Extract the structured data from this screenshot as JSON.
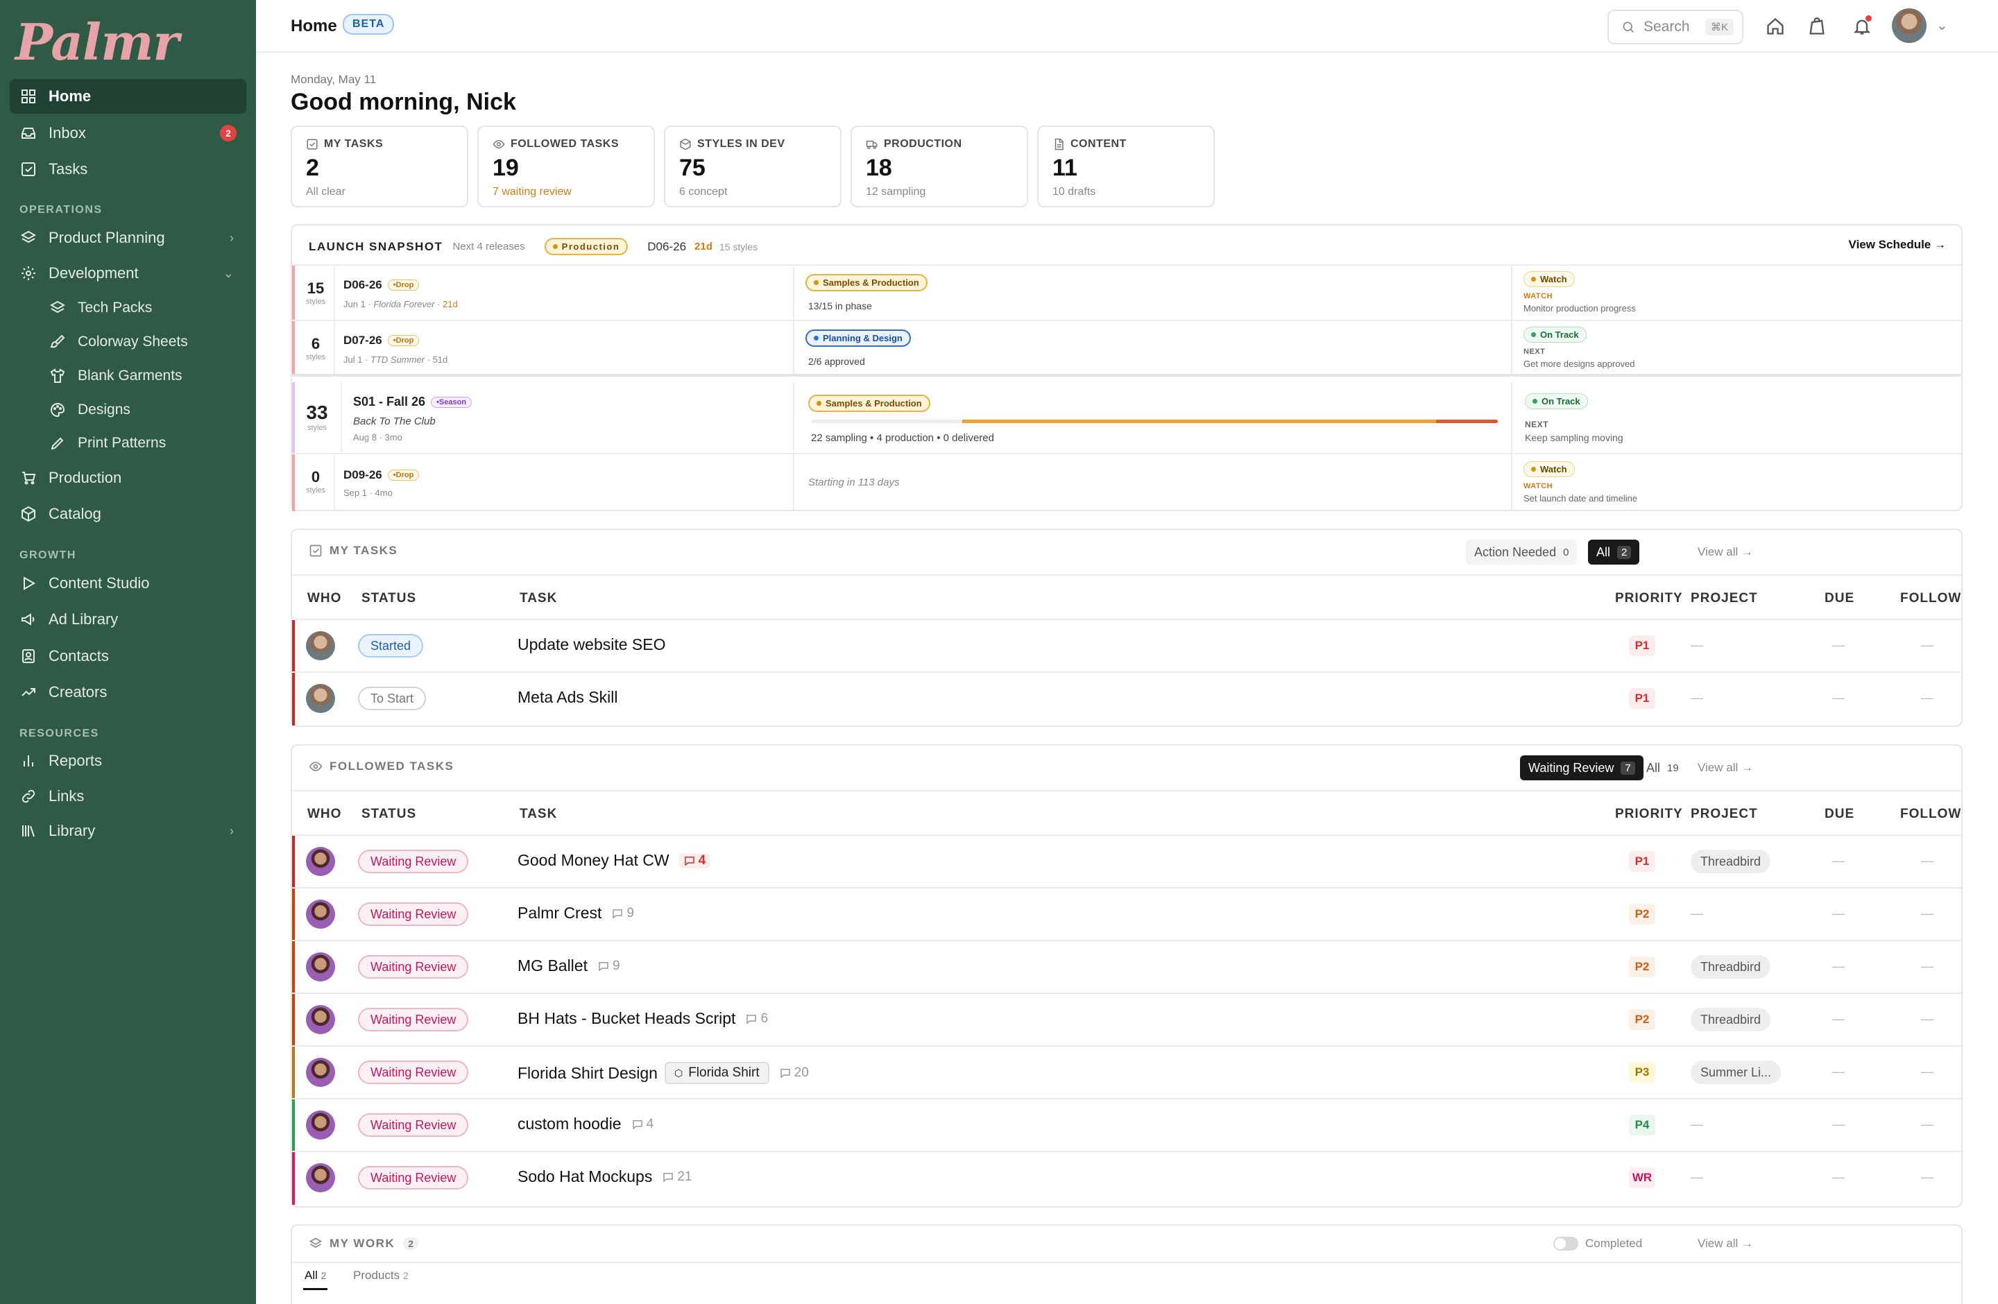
{
  "brand": {
    "logo_text": "Palmr",
    "accent": "#2f5a45",
    "logo_color": "#e7a3a8"
  },
  "sidebar": {
    "home": "Home",
    "inbox": "Inbox",
    "inbox_count": "2",
    "tasks": "Tasks",
    "operations_label": "OPERATIONS",
    "product_planning": "Product Planning",
    "development": "Development",
    "tech_packs": "Tech Packs",
    "colorway_sheets": "Colorway Sheets",
    "blank_garments": "Blank Garments",
    "designs": "Designs",
    "print_patterns": "Print Patterns",
    "production": "Production",
    "catalog": "Catalog",
    "growth_label": "GROWTH",
    "content_studio": "Content Studio",
    "ad_library": "Ad Library",
    "contacts": "Contacts",
    "creators": "Creators",
    "resources_label": "RESOURCES",
    "reports": "Reports",
    "links": "Links",
    "library": "Library"
  },
  "topbar": {
    "crumb": "Home",
    "beta": "BETA",
    "search_placeholder": "Search",
    "search_kbd": "⌘K"
  },
  "header": {
    "date": "Monday, May 11",
    "greeting": "Good morning, Nick"
  },
  "cards": [
    {
      "label": "MY TASKS",
      "value": "2",
      "sub": "All clear",
      "icon": "checkbox-icon"
    },
    {
      "label": "FOLLOWED TASKS",
      "value": "19",
      "sub": "7 waiting review",
      "icon": "eye-icon"
    },
    {
      "label": "STYLES IN DEV",
      "value": "75",
      "sub": "6 concept",
      "icon": "box-icon"
    },
    {
      "label": "PRODUCTION",
      "value": "18",
      "sub": "12 sampling",
      "icon": "truck-icon"
    },
    {
      "label": "CONTENT",
      "value": "11",
      "sub": "10 drafts",
      "icon": "document-icon"
    }
  ],
  "launch": {
    "title": "LAUNCH SNAPSHOT",
    "subtitle": "Next 4 releases",
    "badge": "Production",
    "code": "D06-26",
    "days": "21d",
    "styles": "15 styles",
    "view_schedule": "View Schedule →",
    "styles_label": "styles",
    "rows": [
      {
        "count": "15",
        "name": "D06-26",
        "tag": "Drop",
        "meta": "Jun 1 · ",
        "meta_italic": "Florida Forever",
        "meta_days": " · 21d",
        "phase": "Samples & Production",
        "phase_sub": "13/15 in phase",
        "status": "Watch",
        "next_label": "WATCH",
        "next_text": "Monitor production progress"
      },
      {
        "count": "6",
        "name": "D07-26",
        "tag": "Drop",
        "meta": "Jul 1 · ",
        "meta_italic": "TTD Summer",
        "meta_days": " · 51d",
        "phase": "Planning & Design",
        "phase_sub": "2/6 approved",
        "status": "On Track",
        "next_label": "NEXT",
        "next_text": "Get more designs approved"
      },
      {
        "count": "33",
        "name": "S01 - Fall 26",
        "tag": "Season",
        "sub_title": "Back To The Club",
        "meta": "Aug 8 · 3mo",
        "phase": "Samples & Production",
        "phase_sub": "22 sampling • 4 production • 0 delivered",
        "status": "On Track",
        "next_label": "NEXT",
        "next_text": "Keep sampling moving",
        "progress": {
          "sampling": 0.22,
          "production": 0.69,
          "delivered": 0.09
        }
      },
      {
        "count": "0",
        "name": "D09-26",
        "tag": "Drop",
        "meta": "Sep 1 · 4mo",
        "phase_sub": "Starting in 113 days",
        "status": "Watch",
        "next_label": "WATCH",
        "next_text": "Set launch date and timeline"
      }
    ]
  },
  "my_tasks": {
    "title": "MY TASKS",
    "action_needed": "Action Needed",
    "action_needed_count": "0",
    "all": "All",
    "all_count": "2",
    "view_all": "View all →",
    "columns": [
      "WHO",
      "STATUS",
      "TASK",
      "PRIORITY",
      "PROJECT",
      "DUE",
      "FOLLOW"
    ],
    "rows": [
      {
        "status": "Started",
        "task": "Update website SEO",
        "priority": "P1",
        "project": "—",
        "due": "—",
        "follow": "—"
      },
      {
        "status": "To Start",
        "task": "Meta Ads Skill",
        "priority": "P1",
        "project": "—",
        "due": "—",
        "follow": "—"
      }
    ]
  },
  "followed": {
    "title": "FOLLOWED TASKS",
    "waiting": "Waiting Review",
    "waiting_count": "7",
    "all": "All",
    "all_count": "19",
    "view_all": "View all →",
    "columns": [
      "WHO",
      "STATUS",
      "TASK",
      "PRIORITY",
      "PROJECT",
      "DUE",
      "FOLLOW"
    ],
    "rows": [
      {
        "status": "Waiting Review",
        "task": "Good Money Hat CW",
        "comments": "4",
        "priority": "P1",
        "project": "Threadbird",
        "due": "—",
        "follow": "—"
      },
      {
        "status": "Waiting Review",
        "task": "Palmr Crest",
        "comments": "9",
        "priority": "P2",
        "project": "—",
        "due": "—",
        "follow": "—"
      },
      {
        "status": "Waiting Review",
        "task": "MG Ballet",
        "comments": "9",
        "priority": "P2",
        "project": "Threadbird",
        "due": "—",
        "follow": "—"
      },
      {
        "status": "Waiting Review",
        "task": "BH Hats - Bucket Heads Script",
        "comments": "6",
        "priority": "P2",
        "project": "Threadbird",
        "due": "—",
        "follow": "—"
      },
      {
        "status": "Waiting Review",
        "task": "Florida Shirt Design",
        "chip": "Florida Shirt",
        "comments": "20",
        "priority": "P3",
        "project": "Summer Li...",
        "due": "—",
        "follow": "—"
      },
      {
        "status": "Waiting Review",
        "task": "custom hoodie",
        "comments": "4",
        "priority": "P4",
        "project": "—",
        "due": "—",
        "follow": "—"
      },
      {
        "status": "Waiting Review",
        "task": "Sodo Hat Mockups",
        "comments": "21",
        "priority": "WR",
        "project": "—",
        "due": "—",
        "follow": "—"
      }
    ]
  },
  "my_work": {
    "title": "MY WORK",
    "count": "2",
    "completed": "Completed",
    "view_all": "View all →",
    "tab_all": "All",
    "tab_all_count": "2",
    "tab_products": "Products",
    "tab_products_count": "2"
  }
}
